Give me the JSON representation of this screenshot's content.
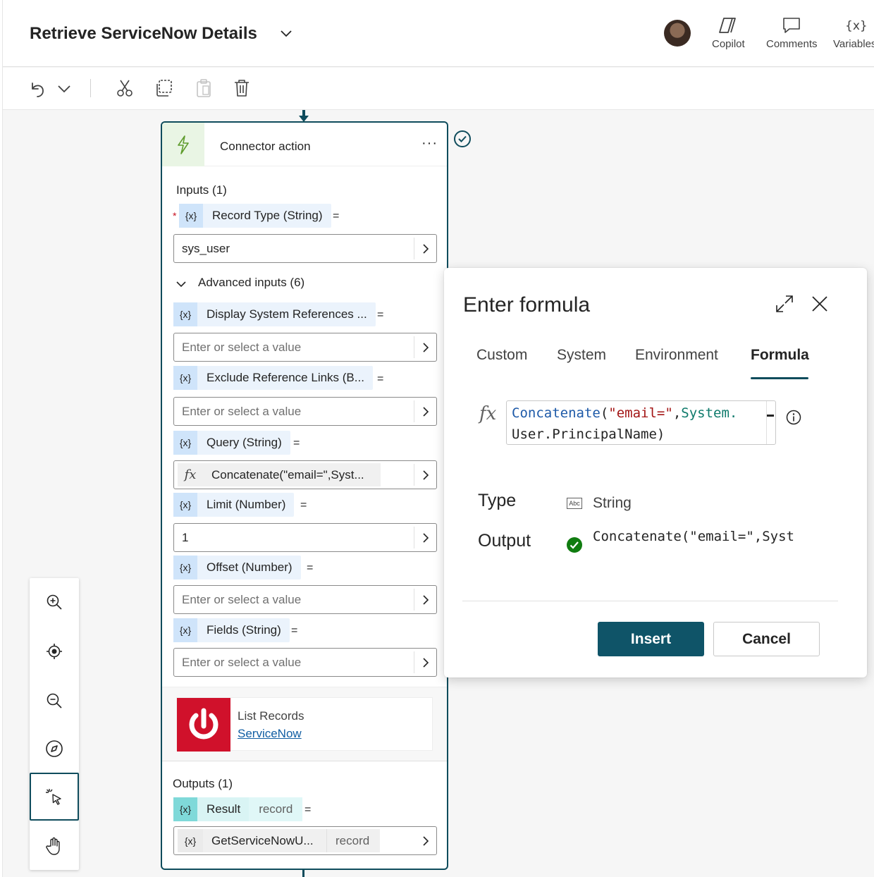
{
  "header": {
    "title": "Retrieve ServiceNow Details",
    "buttons": {
      "copilot": "Copilot",
      "comments": "Comments",
      "variables": "Variables"
    }
  },
  "node": {
    "title": "Connector action",
    "more": "···",
    "inputs_label": "Inputs (1)",
    "record_type": {
      "label": "Record Type (String)",
      "value": "sys_user"
    },
    "advanced_label": "Advanced inputs (6)",
    "advanced": [
      {
        "label": "Display System References ...",
        "placeholder": "Enter or select a value"
      },
      {
        "label": "Exclude Reference Links (B...",
        "placeholder": "Enter or select a value"
      },
      {
        "label": "Query (String)",
        "value": "Concatenate(\"email=\",Syst..."
      },
      {
        "label": "Limit (Number)",
        "value": "1"
      },
      {
        "label": "Offset (Number)",
        "placeholder": "Enter or select a value"
      },
      {
        "label": "Fields (String)",
        "placeholder": "Enter or select a value"
      }
    ],
    "connector": {
      "name": "List Records",
      "link": "ServiceNow"
    },
    "outputs_label": "Outputs (1)",
    "output": {
      "label": "Result",
      "type": "record",
      "value": "GetServiceNowU...",
      "value_type": "record"
    },
    "var_glyph": "{x}",
    "eq": "=",
    "required_mark": "*",
    "fx_glyph": "fx"
  },
  "formula_panel": {
    "title": "Enter formula",
    "tabs": [
      "Custom",
      "System",
      "Environment",
      "Formula"
    ],
    "selected_tab": "Formula",
    "fx_glyph": "fx",
    "formula": {
      "fn": "Concatenate",
      "open": "(",
      "str": "\"email=\"",
      "comma": ",",
      "sys": "System.",
      "line2": "User.PrincipalName",
      "close": ")"
    },
    "type_label": "Type",
    "type_icon_text": "Abc",
    "type_value": "String",
    "output_label": "Output",
    "output_value": "Concatenate(\"email=\",Syst",
    "insert_label": "Insert",
    "cancel_label": "Cancel"
  },
  "colors": {
    "accent": "#0f4c5c",
    "insert_bg": "#0f5468",
    "servicenow_red": "#d0112b",
    "ok_green": "#107c10"
  }
}
